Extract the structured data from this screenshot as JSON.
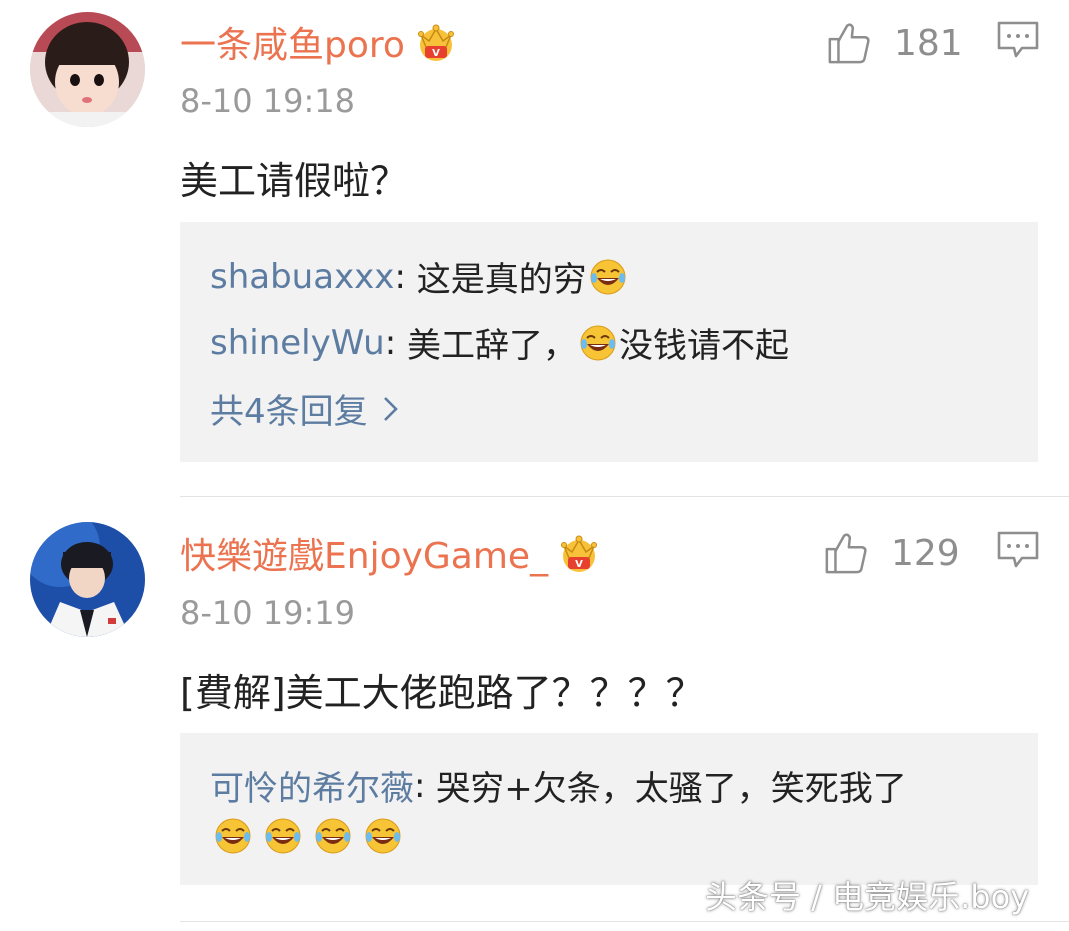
{
  "comments": [
    {
      "username": "一条咸鱼poro",
      "timestamp": "8-10 19:18",
      "text": "美工请假啦？",
      "likes": "181",
      "replies": [
        {
          "user": "shabuaxxx",
          "sep": ": ",
          "text": "这是真的穷"
        },
        {
          "user": "shinelyWu",
          "sep": ": ",
          "text_before": "美工辞了，",
          "text_after": "没钱请不起"
        }
      ],
      "more_replies": "共4条回复"
    },
    {
      "username": "快樂遊戲EnjoyGame_",
      "timestamp": "8-10 19:19",
      "text": "[費解]美工大佬跑路了？？？？",
      "likes": "129",
      "replies": [
        {
          "user": "可怜的希尔薇",
          "sep": ": ",
          "text": "哭穷+欠条，太骚了，笑死我了"
        }
      ]
    }
  ],
  "watermark": "头条号 / 电竞娱乐.boy",
  "colors": {
    "username": "#eb7350",
    "reply_user": "#5d7ca1",
    "timestamp": "#9a9a9a",
    "reply_bg": "#f2f2f2"
  },
  "icons": [
    "crown-vip-icon",
    "thumbs-up-icon",
    "comment-reply-icon",
    "laugh-cry-emoji",
    "chevron-right-icon"
  ]
}
